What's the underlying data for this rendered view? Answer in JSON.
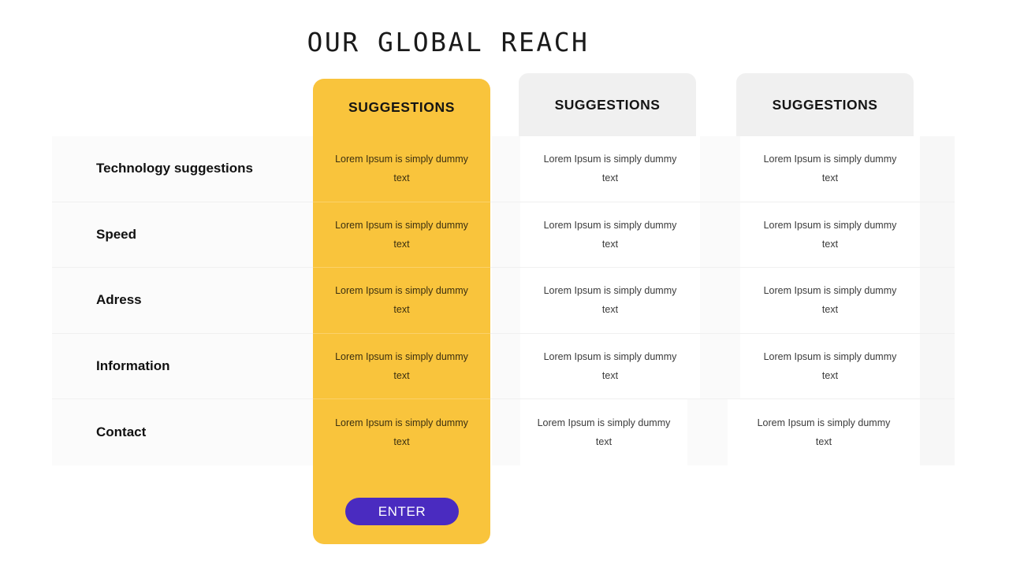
{
  "title": "OUR GLOBAL REACH",
  "colors": {
    "accent_yellow": "#F9C43C",
    "header_gray": "#F0F0F0",
    "button_purple": "#4A2BC0",
    "text_dark": "#141414",
    "cell_text": "#3b3b3b"
  },
  "columns": [
    {
      "header": "SUGGESTIONS",
      "highlighted": true
    },
    {
      "header": "SUGGESTIONS",
      "highlighted": false
    },
    {
      "header": "SUGGESTIONS",
      "highlighted": false
    }
  ],
  "rows": [
    {
      "label": "Technology suggestions",
      "col1": "Lorem Ipsum is simply dummy text",
      "col2": "Lorem Ipsum is simply dummy text",
      "col3": "Lorem Ipsum is simply dummy text"
    },
    {
      "label": "Speed",
      "col1": "Lorem Ipsum is simply dummy text",
      "col2": "Lorem Ipsum is simply dummy text",
      "col3": "Lorem Ipsum is simply dummy text"
    },
    {
      "label": "Adress",
      "col1": "Lorem Ipsum is simply dummy text",
      "col2": "Lorem Ipsum is simply dummy text",
      "col3": "Lorem Ipsum is simply dummy text"
    },
    {
      "label": "Information",
      "col1": "Lorem Ipsum is simply dummy text",
      "col2": "Lorem Ipsum is simply dummy text",
      "col3": "Lorem Ipsum is simply dummy text"
    },
    {
      "label": "Contact",
      "col1": "Lorem Ipsum is simply dummy text",
      "col2": "Lorem Ipsum is simply dummy text",
      "col3": "Lorem Ipsum is simply dummy text"
    }
  ],
  "cta": {
    "label": "ENTER"
  }
}
